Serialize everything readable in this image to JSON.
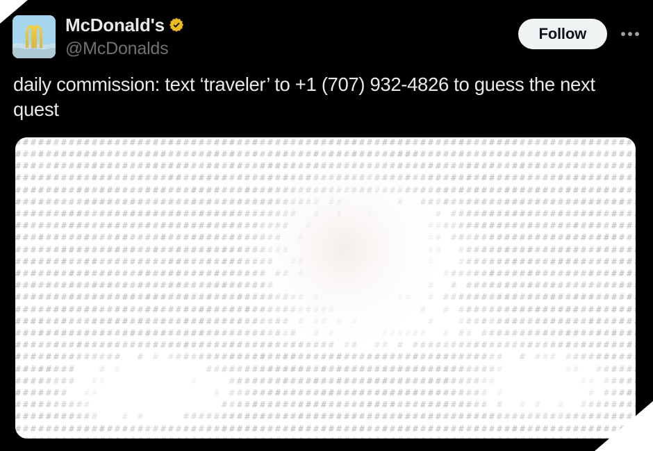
{
  "post": {
    "author": {
      "display_name": "McDonald's",
      "handle": "@McDonalds",
      "verified": true,
      "verified_badge_color": "#e8b923",
      "avatar_alt": "mcdonalds-golden-arches-logo"
    },
    "body_text": "daily commission: text ‘traveler’ to +1 (707) 932-4826 to guess the next quest",
    "actions": {
      "follow_label": "Follow",
      "more_label": "•••"
    },
    "media": {
      "alt": "ascii-art-halftone-photograph",
      "render_character": "#",
      "background_color": "#ffffff",
      "ink_color": "#8a8a8a",
      "tint_color": "#e8d8d2"
    }
  },
  "theme": {
    "background": "#000000",
    "text_primary": "#e7e9ea",
    "text_secondary": "#6e7276",
    "follow_button_bg": "#eff3f4",
    "follow_button_text": "#0f1419",
    "corner_accent": "#ffffff"
  }
}
